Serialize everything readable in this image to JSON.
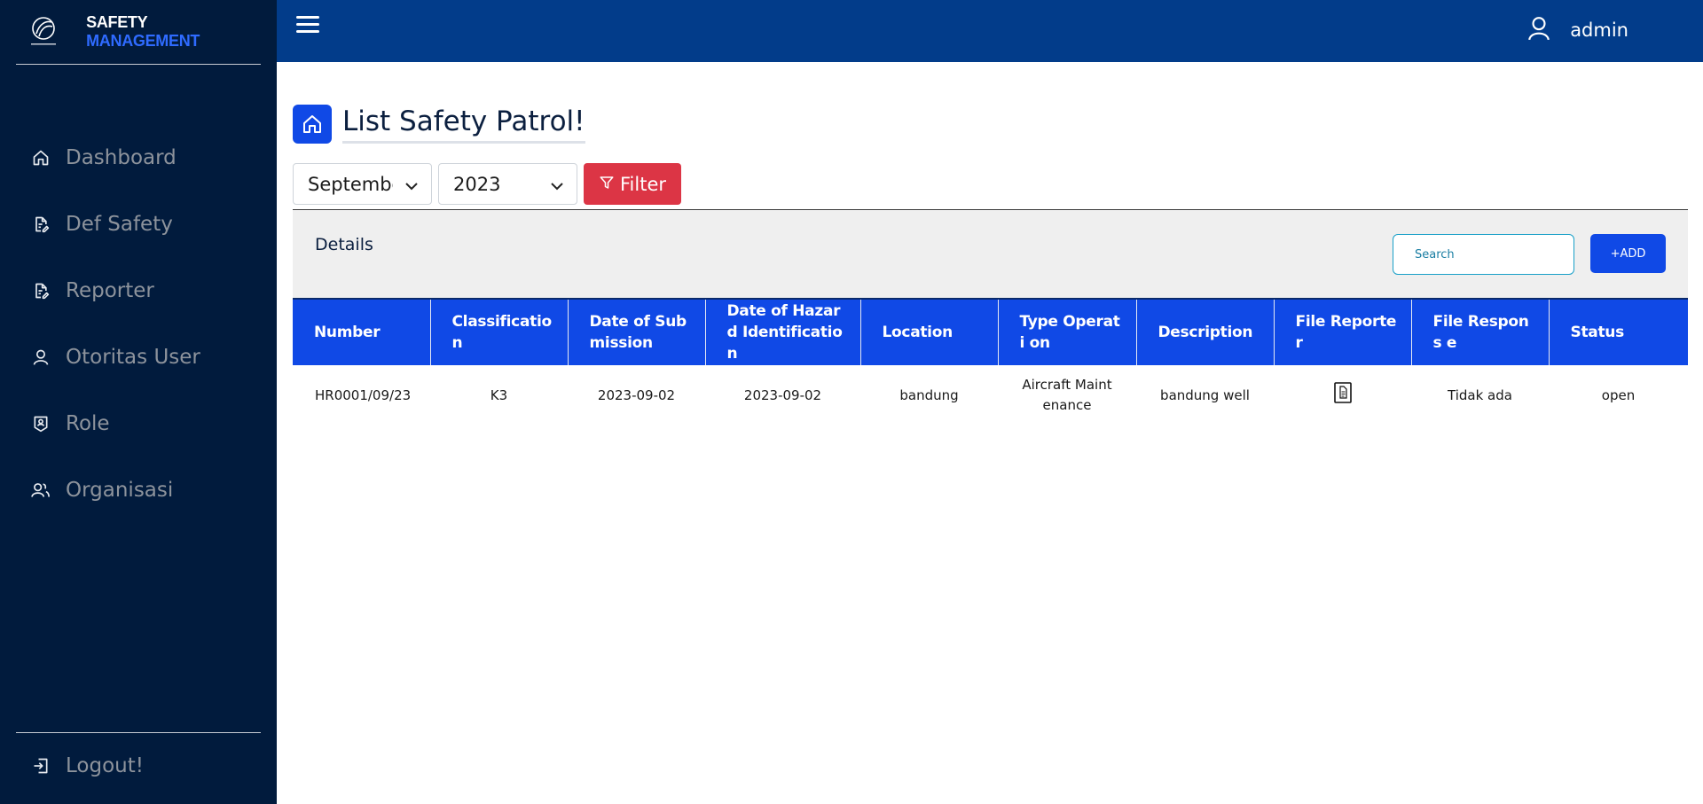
{
  "brand": {
    "word1": "SAFETY",
    "word2": "MANAGEMENT"
  },
  "sidebar": {
    "items": [
      {
        "label": "Dashboard",
        "icon": "home-icon"
      },
      {
        "label": "Def Safety",
        "icon": "document-edit-icon"
      },
      {
        "label": "Reporter",
        "icon": "document-edit-icon"
      },
      {
        "label": "Otoritas User",
        "icon": "user-icon"
      },
      {
        "label": "Role",
        "icon": "badge-icon"
      },
      {
        "label": "Organisasi",
        "icon": "users-icon"
      }
    ],
    "logout": "Logout!"
  },
  "topbar": {
    "username": "admin"
  },
  "page": {
    "title": "List Safety Patrol!"
  },
  "filters": {
    "month": "September",
    "year": "2023",
    "filter_label": "Filter"
  },
  "card": {
    "title": "Details",
    "search_placeholder": "Search",
    "add_label": "+ADD"
  },
  "table": {
    "headers": [
      "Number",
      "Classificatio n",
      "Date of Sub mission",
      "Date of Hazard Identification",
      "Location",
      "Type Operati on",
      "Description",
      "File Reporter",
      "File Respons e",
      "Status"
    ],
    "rows": [
      {
        "number": "HR0001/09/23",
        "classification": "K3",
        "date_submission": "2023-09-02",
        "date_hazard": "2023-09-02",
        "location": "bandung",
        "type_operation": "Aircraft Maint enance",
        "description": "bandung well",
        "file_reporter": "file-icon",
        "file_response": "Tidak ada",
        "status": "open"
      }
    ]
  },
  "colors": {
    "sidebar": "#011b3d",
    "topbar": "#023c8a",
    "primary": "#1049e6",
    "danger": "#dc3545"
  }
}
